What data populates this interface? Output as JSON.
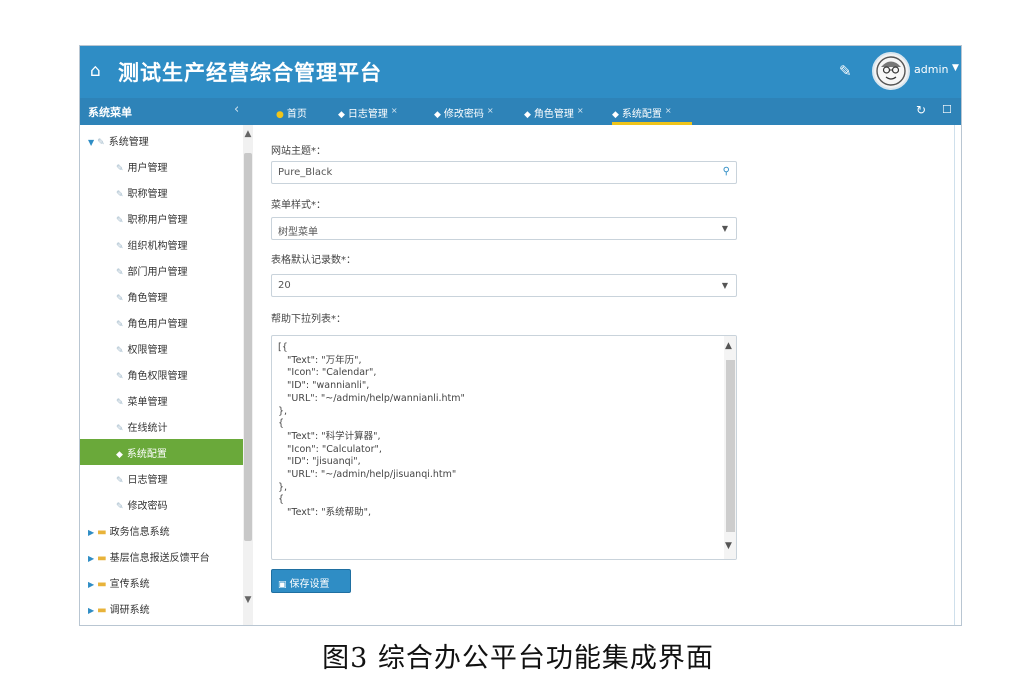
{
  "header": {
    "title": "测试生产经营综合管理平台",
    "user_name": "admin"
  },
  "navbar": {
    "sidebar_title": "系统菜单",
    "tabs": [
      {
        "label": "首页"
      },
      {
        "label": "日志管理"
      },
      {
        "label": "修改密码"
      },
      {
        "label": "角色管理"
      },
      {
        "label": "系统配置"
      }
    ]
  },
  "sidebar": {
    "items": [
      {
        "label": "系统管理"
      },
      {
        "label": "用户管理"
      },
      {
        "label": "职称管理"
      },
      {
        "label": "职称用户管理"
      },
      {
        "label": "组织机构管理"
      },
      {
        "label": "部门用户管理"
      },
      {
        "label": "角色管理"
      },
      {
        "label": "角色用户管理"
      },
      {
        "label": "权限管理"
      },
      {
        "label": "角色权限管理"
      },
      {
        "label": "菜单管理"
      },
      {
        "label": "在线统计"
      },
      {
        "label": "系统配置"
      },
      {
        "label": "日志管理"
      },
      {
        "label": "修改密码"
      },
      {
        "label": "政务信息系统"
      },
      {
        "label": "基层信息报送反馈平台"
      },
      {
        "label": "宣传系统"
      },
      {
        "label": "调研系统"
      }
    ]
  },
  "form": {
    "theme_label": "网站主题*：",
    "theme_value": "Pure_Black",
    "menu_style_label": "菜单样式*：",
    "menu_style_value": "树型菜单",
    "page_size_label": "表格默认记录数*：",
    "page_size_value": "20",
    "help_label": "帮助下拉列表*：",
    "help_lines": "[{\n   \"Text\": \"万年历\",\n   \"Icon\": \"Calendar\",\n   \"ID\": \"wannianli\",\n   \"URL\": \"~/admin/help/wannianli.htm\"\n},\n{\n   \"Text\": \"科学计算器\",\n   \"Icon\": \"Calculator\",\n   \"ID\": \"jisuanqi\",\n   \"URL\": \"~/admin/help/jisuanqi.htm\"\n},\n{\n   \"Text\": \"系统帮助\",",
    "save_label": "保存设置"
  },
  "caption": "图3  综合办公平台功能集成界面"
}
